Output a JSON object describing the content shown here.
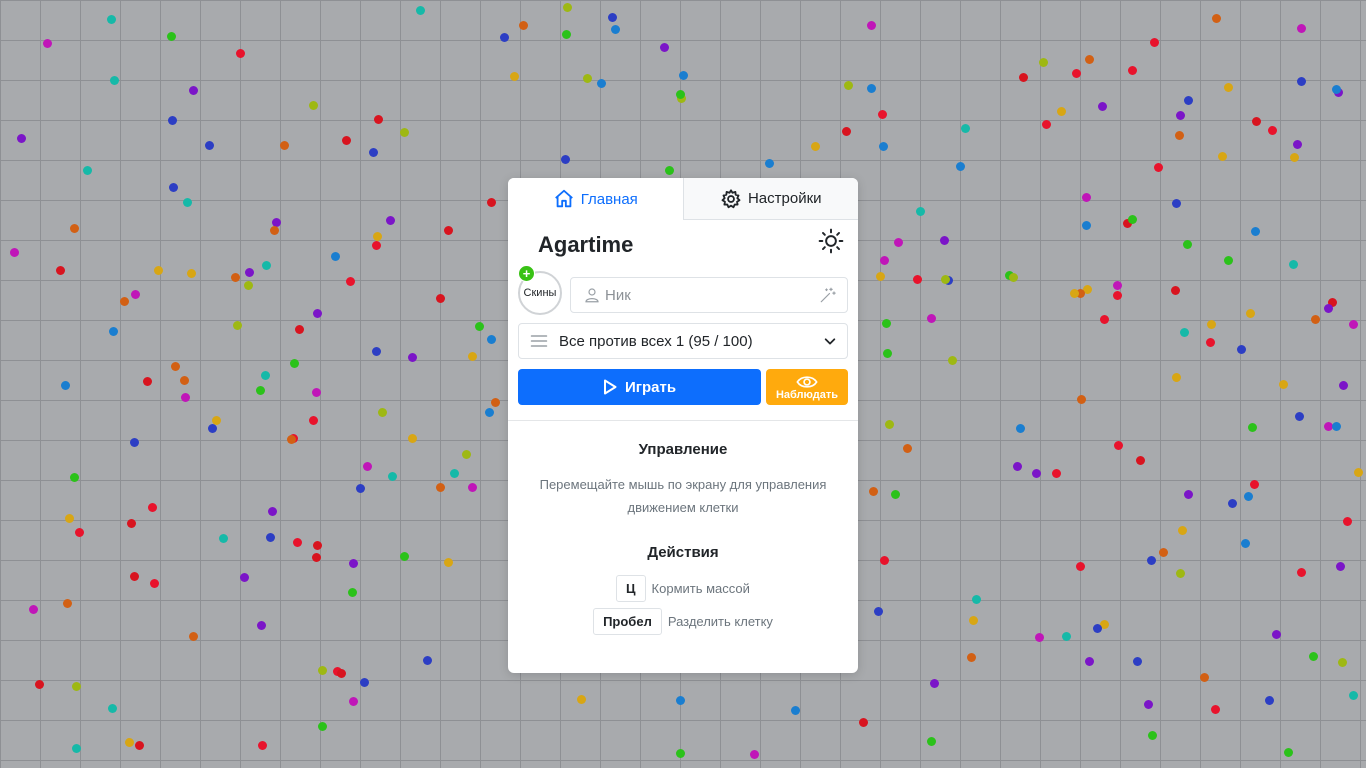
{
  "tabs": [
    {
      "label": "Главная",
      "icon": "home-icon",
      "active": true
    },
    {
      "label": "Настройки",
      "icon": "gear-icon",
      "active": false
    }
  ],
  "app": {
    "title": "Agartime",
    "theme_icon": "sun-icon"
  },
  "skins": {
    "label": "Скины",
    "badge": "+"
  },
  "nick": {
    "placeholder": "Ник",
    "value": "",
    "user_icon": "user-icon",
    "random_icon": "magic-wand-icon"
  },
  "mode": {
    "selected": "Все против всех 1 (95 / 100)",
    "icon": "list-icon"
  },
  "buttons": {
    "play": "Играть",
    "spectate": "Наблюдать"
  },
  "controls": {
    "title": "Управление",
    "text": "Перемещайте мышь по экрану для управления движением клетки"
  },
  "actions": {
    "title": "Действия",
    "items": [
      {
        "key": "Ц",
        "label": "Кормить массой"
      },
      {
        "key": "Пробел",
        "label": "Разделить клетку"
      }
    ]
  },
  "colors": {
    "accent": "#0d6efd",
    "spectate": "#ffaa0d",
    "background": "#a8aaad",
    "pellets": [
      "#2c3ec4",
      "#c016b8",
      "#16b9a8",
      "#2bc21a",
      "#d8141f",
      "#9eb813",
      "#d8a614",
      "#d26014",
      "#7b15c8",
      "#1a7ed0",
      "#e8132c"
    ]
  }
}
